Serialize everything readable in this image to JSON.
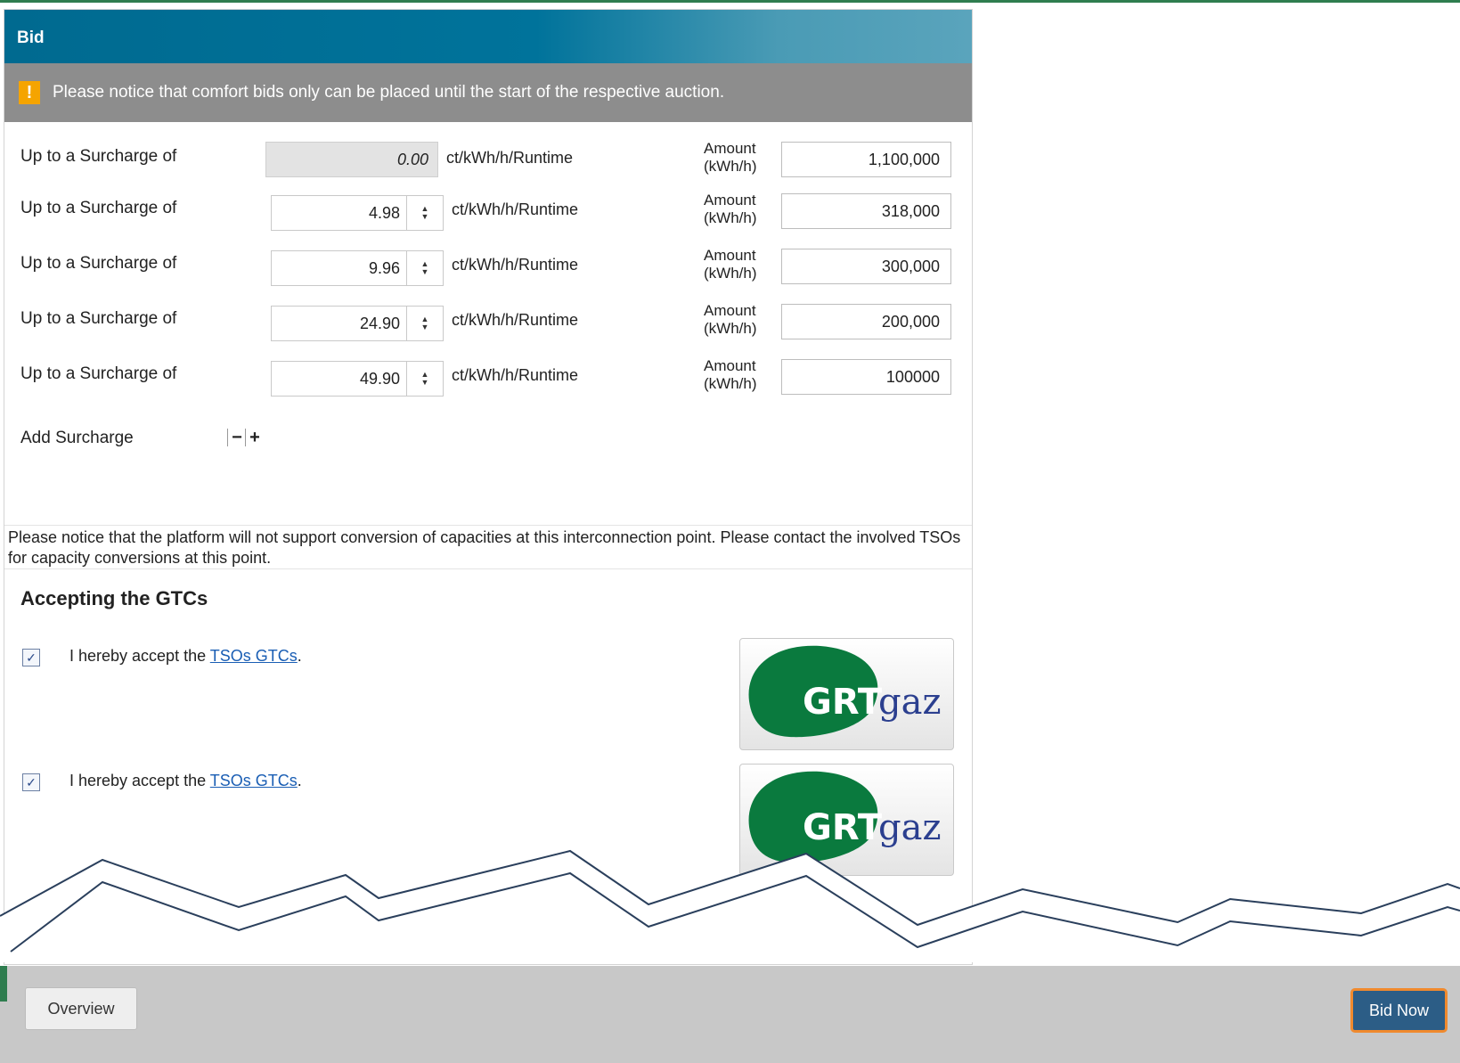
{
  "panel": {
    "title": "Bid"
  },
  "notice": {
    "icon": "warning-icon",
    "text": "Please notice that comfort bids only can be placed until the start of the respective auction."
  },
  "rows": [
    {
      "label": "Up to a Surcharge of",
      "surcharge": "0.00",
      "unit": "ct/kWh/h/Runtime",
      "amount_label_1": "Amount",
      "amount_label_2": "(kWh/h)",
      "amount": "1,100,000"
    },
    {
      "label": "Up to a Surcharge of",
      "surcharge": "4.98",
      "unit": "ct/kWh/h/Runtime",
      "amount_label_1": "Amount",
      "amount_label_2": "(kWh/h)",
      "amount": "318,000"
    },
    {
      "label": "Up to a Surcharge of",
      "surcharge": "9.96",
      "unit": "ct/kWh/h/Runtime",
      "amount_label_1": "Amount",
      "amount_label_2": "(kWh/h)",
      "amount": "300,000"
    },
    {
      "label": "Up to a Surcharge of",
      "surcharge": "24.90",
      "unit": "ct/kWh/h/Runtime",
      "amount_label_1": "Amount",
      "amount_label_2": "(kWh/h)",
      "amount": "200,000"
    },
    {
      "label": "Up to a Surcharge of",
      "surcharge": "49.90",
      "unit": "ct/kWh/h/Runtime",
      "amount_label_1": "Amount",
      "amount_label_2": "(kWh/h)",
      "amount": "100000"
    }
  ],
  "add_surcharge": {
    "label": "Add Surcharge",
    "minus": "−",
    "plus": "+"
  },
  "conversion_notice": "Please notice that the platform will not support conversion of capacities at this interconnection point. Please contact the involved TSOs for capacity conversions at this point.",
  "gtc": {
    "title": "Accepting the GTCs",
    "items": [
      {
        "checked": true,
        "text_before": "I hereby accept the ",
        "link": "TSOs GTCs",
        "text_after": ".",
        "logo_left": "GRT",
        "logo_right": "gaz"
      },
      {
        "checked": true,
        "text_before": "I hereby accept the ",
        "link": "TSOs GTCs",
        "text_after": ".",
        "logo_left": "GRT",
        "logo_right": "gaz"
      }
    ]
  },
  "footer": {
    "overview": "Overview",
    "bid_now": "Bid Now"
  },
  "colors": {
    "header": "#00739b",
    "notice_bg": "#8d8d8d",
    "warning": "#f5a400",
    "logo_green": "#0a7a3e",
    "logo_blue": "#2b3f8f",
    "bid_now": "#2c5d86",
    "bid_now_border": "#f08a2e"
  }
}
